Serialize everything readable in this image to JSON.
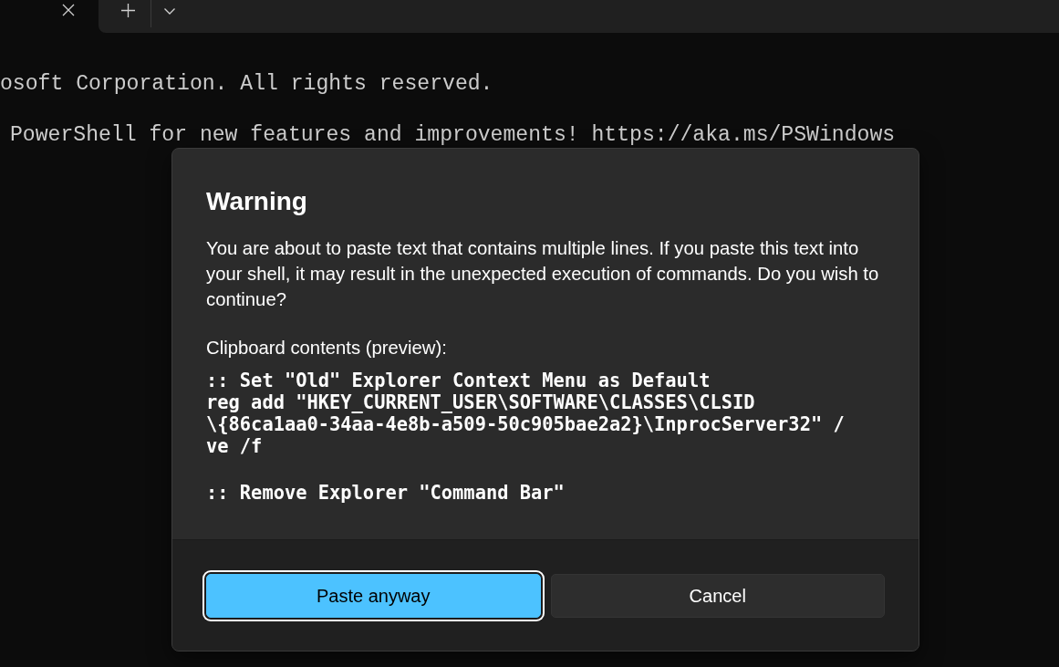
{
  "tab_bar": {
    "tabs": [
      {
        "selected": true
      }
    ]
  },
  "terminal": {
    "lines": [
      "osoft Corporation. All rights reserved.",
      "PowerShell for new features and improvements! https://aka.ms/PSWindows"
    ]
  },
  "dialog": {
    "title": "Warning",
    "message": "You are about to paste text that contains multiple lines. If you paste this text into your shell, it may result in the unexpected execution of commands. Do you wish to continue?",
    "clipboard_label": "Clipboard contents (preview):",
    "clipboard_preview": [
      [
        ":: Set \"Old\" Explorer Context Menu as Default",
        "reg add \"HKEY_CURRENT_USER\\SOFTWARE\\CLASSES\\CLSID",
        "\\{86ca1aa0-34aa-4e8b-a509-50c905bae2a2}\\InprocServer32\" /",
        "ve /f"
      ],
      [
        ":: Remove Explorer \"Command Bar\""
      ]
    ],
    "buttons": [
      {
        "label": "Paste anyway",
        "kind": "primary",
        "focused": true
      },
      {
        "label": "Cancel",
        "kind": "secondary",
        "focused": false
      }
    ]
  }
}
